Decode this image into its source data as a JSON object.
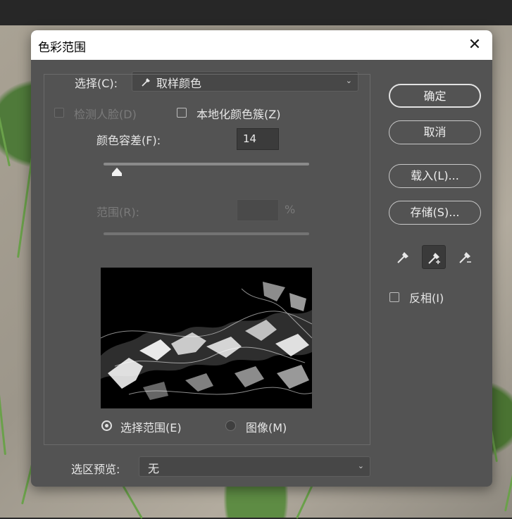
{
  "dialog": {
    "title": "色彩范围",
    "close_glyph": "✕"
  },
  "select": {
    "label": "选择(C):",
    "value": "取样颜色",
    "icon": "eyedropper-icon"
  },
  "options": {
    "detect_faces": "检测人脸(D)",
    "localized_clusters": "本地化颜色簇(Z)"
  },
  "fuzziness": {
    "label": "颜色容差(F):",
    "value": "14"
  },
  "range": {
    "label": "范围(R):",
    "value": "",
    "unit": "%"
  },
  "preview_mode": {
    "selection": "选择范围(E)",
    "image": "图像(M)",
    "selected": "selection"
  },
  "selection_preview": {
    "label": "选区预览:",
    "value": "无"
  },
  "buttons": {
    "ok": "确定",
    "cancel": "取消",
    "load": "载入(L)...",
    "save": "存储(S)..."
  },
  "eyedroppers": [
    "eyedropper-icon",
    "eyedropper-plus-icon",
    "eyedropper-minus-icon"
  ],
  "invert": {
    "label": "反相(I)",
    "checked": false
  },
  "colors": {
    "dialog_bg": "#535353",
    "title_bg": "#ffffff",
    "text": "#e6e6e6",
    "dim_text": "#7a7a7a"
  }
}
